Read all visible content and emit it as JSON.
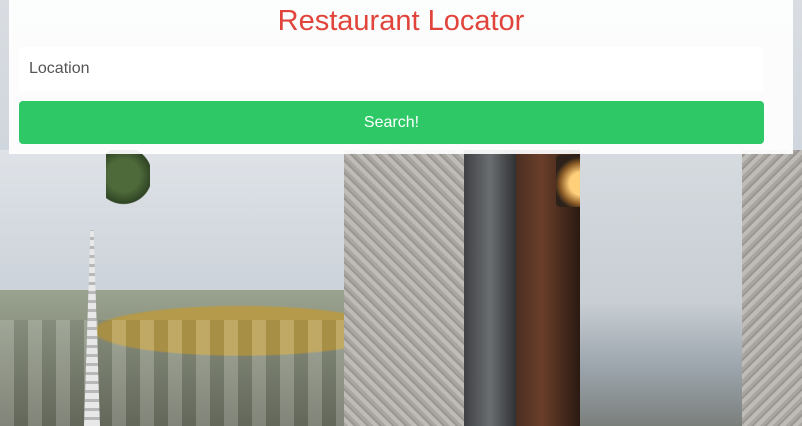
{
  "header": {
    "title": "Restaurant Locator"
  },
  "search": {
    "placeholder": "Location",
    "value": "",
    "button_label": "Search!"
  },
  "colors": {
    "title": "#e0443a",
    "button": "#2ec866",
    "button_text": "#ffffff",
    "panel": "#ffffff"
  }
}
